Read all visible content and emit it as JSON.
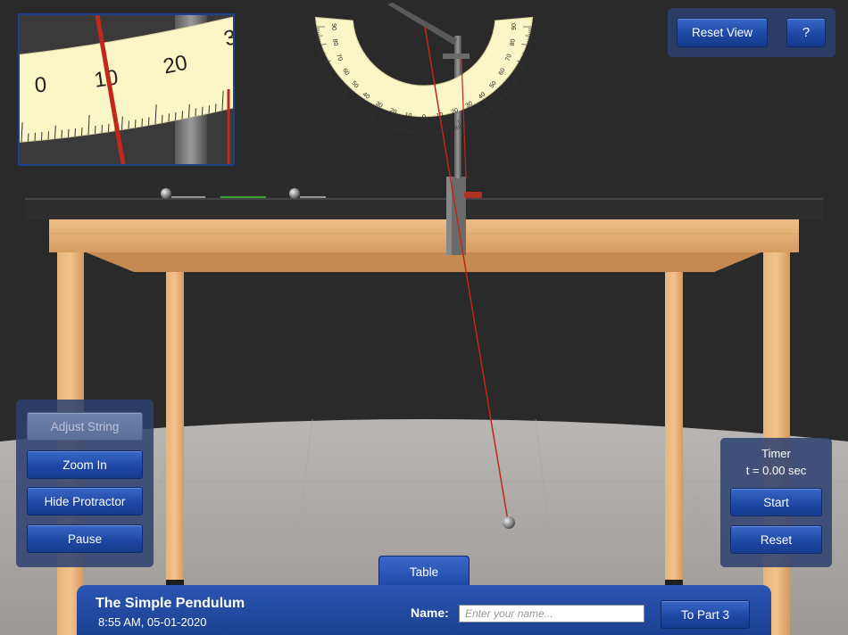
{
  "controls": {
    "adjust_string": "Adjust String",
    "zoom_in": "Zoom In",
    "hide_protractor": "Hide Protractor",
    "pause": "Pause"
  },
  "view": {
    "reset_view": "Reset View",
    "help": "?"
  },
  "timer": {
    "title": "Timer",
    "value": "t = 0.00 sec",
    "start": "Start",
    "reset": "Reset"
  },
  "tab": {
    "label": "Table"
  },
  "footer": {
    "title": "The Simple Pendulum",
    "datetime": "8:55 AM, 05-01-2020",
    "name_label": "Name:",
    "name_placeholder": "Enter your name...",
    "name_value": "",
    "next_label": "To Part 3"
  },
  "zoom_scale": {
    "labels": [
      "0",
      "10",
      "20",
      "3"
    ]
  },
  "protractor": {
    "labels_left": [
      "90",
      "80",
      "70",
      "60",
      "50",
      "40",
      "30",
      "20",
      "10"
    ],
    "center_label": "0",
    "labels_right": [
      "10",
      "20",
      "30",
      "40",
      "50",
      "60",
      "70",
      "80",
      "90"
    ]
  },
  "colors": {
    "background": "#2a2a2a",
    "panel": "#2c4070",
    "button": "#1e48a6",
    "string": "#c0281c",
    "wood": "#e0a86a",
    "tabletop": "#2e2e2e",
    "scale": "#fbf6c8"
  }
}
